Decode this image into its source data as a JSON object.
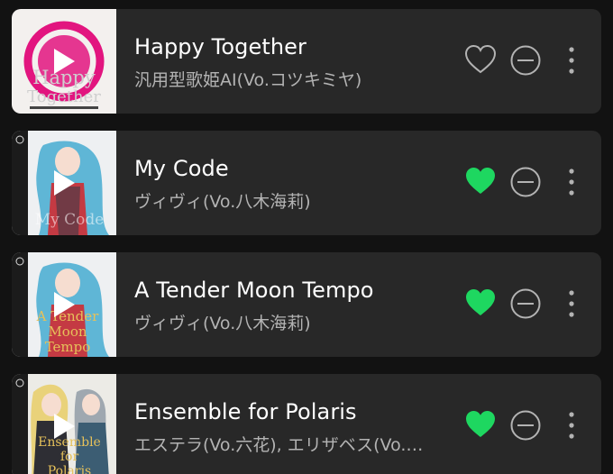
{
  "colors": {
    "background": "#121212",
    "card": "#282828",
    "title": "#ffffff",
    "subtitle": "#b3b3b3",
    "liked": "#1ed760",
    "icon": "#b3b3b3"
  },
  "tracks": [
    {
      "title": "Happy Together",
      "artist": "汎用型歌姫AI(Vo.コツキミヤ)",
      "liked": false,
      "cover_text": [
        "Happy",
        "Together"
      ]
    },
    {
      "title": "My Code",
      "artist": "ヴィヴィ(Vo.八木海莉)",
      "liked": true,
      "cover_text": [
        "My Code"
      ]
    },
    {
      "title": "A Tender Moon Tempo",
      "artist": "ヴィヴィ(Vo.八木海莉)",
      "liked": true,
      "cover_text": [
        "A Tender",
        "Moon",
        "Tempo"
      ]
    },
    {
      "title": "Ensemble for Polaris",
      "artist": "エステラ(Vo.六花), エリザベス(Vo.…",
      "liked": true,
      "cover_text": [
        "Ensemble",
        "for",
        "Polaris"
      ]
    }
  ]
}
